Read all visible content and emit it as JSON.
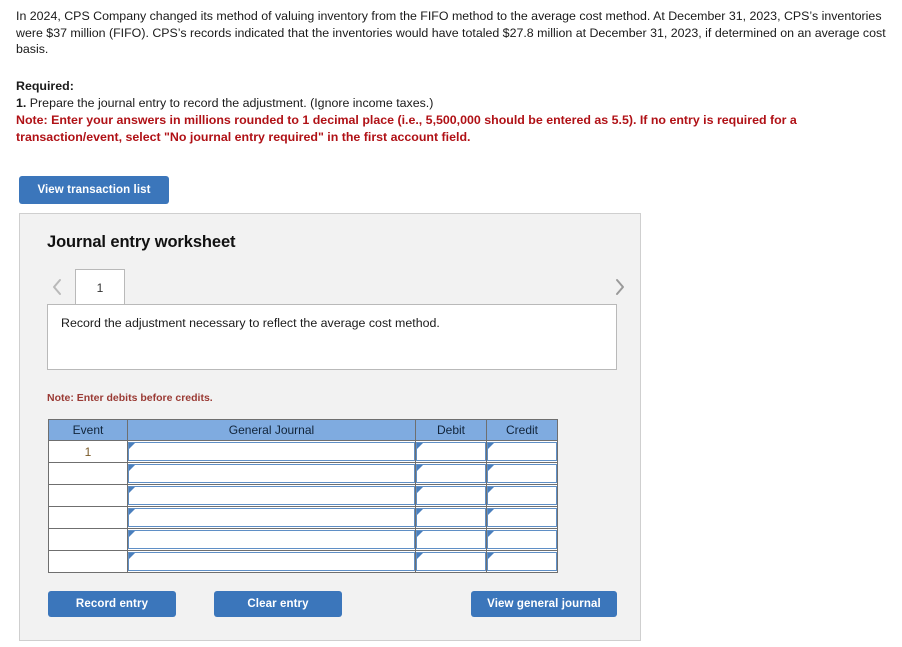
{
  "problem": {
    "text": "In 2024, CPS Company changed its method of valuing inventory from the FIFO method to the average cost method. At December 31, 2023, CPS’s inventories were $37 million (FIFO). CPS’s records indicated that the inventories would have totaled $27.8 million at December 31, 2023, if determined on an average cost basis."
  },
  "required": {
    "label": "Required:",
    "item_number": "1.",
    "item_text": " Prepare the journal entry to record the adjustment. (Ignore income taxes.)",
    "note": "Note: Enter your answers in millions rounded to 1 decimal place (i.e., 5,500,000 should be entered as 5.5). If no entry is required for a transaction/event, select \"No journal entry required\" in the first account field."
  },
  "toolbar": {
    "view_transaction_list_label": "View transaction list"
  },
  "worksheet": {
    "title": "Journal entry worksheet",
    "tabs": [
      {
        "label": "1",
        "active": true
      }
    ],
    "nav": {
      "prev_icon": "chevron-left-icon",
      "next_icon": "chevron-right-icon"
    },
    "description": "Record the adjustment necessary to reflect the average cost method.",
    "credit_note": "Note: Enter debits before credits.",
    "table": {
      "columns": [
        "Event",
        "General Journal",
        "Debit",
        "Credit"
      ],
      "rows": [
        {
          "event": "1",
          "general_journal": "",
          "debit": "",
          "credit": ""
        },
        {
          "event": "",
          "general_journal": "",
          "debit": "",
          "credit": ""
        },
        {
          "event": "",
          "general_journal": "",
          "debit": "",
          "credit": ""
        },
        {
          "event": "",
          "general_journal": "",
          "debit": "",
          "credit": ""
        },
        {
          "event": "",
          "general_journal": "",
          "debit": "",
          "credit": ""
        },
        {
          "event": "",
          "general_journal": "",
          "debit": "",
          "credit": ""
        }
      ]
    },
    "actions": {
      "record_entry_label": "Record entry",
      "clear_entry_label": "Clear entry",
      "view_general_journal_label": "View general journal"
    }
  },
  "colors": {
    "button_blue": "#3b76bb",
    "table_header_blue": "#7fabe0",
    "note_red": "#b01116",
    "credit_note_red": "#9a3a34",
    "panel_background": "#f2f2f2",
    "cell_border_blue": "#5f8fc6"
  }
}
